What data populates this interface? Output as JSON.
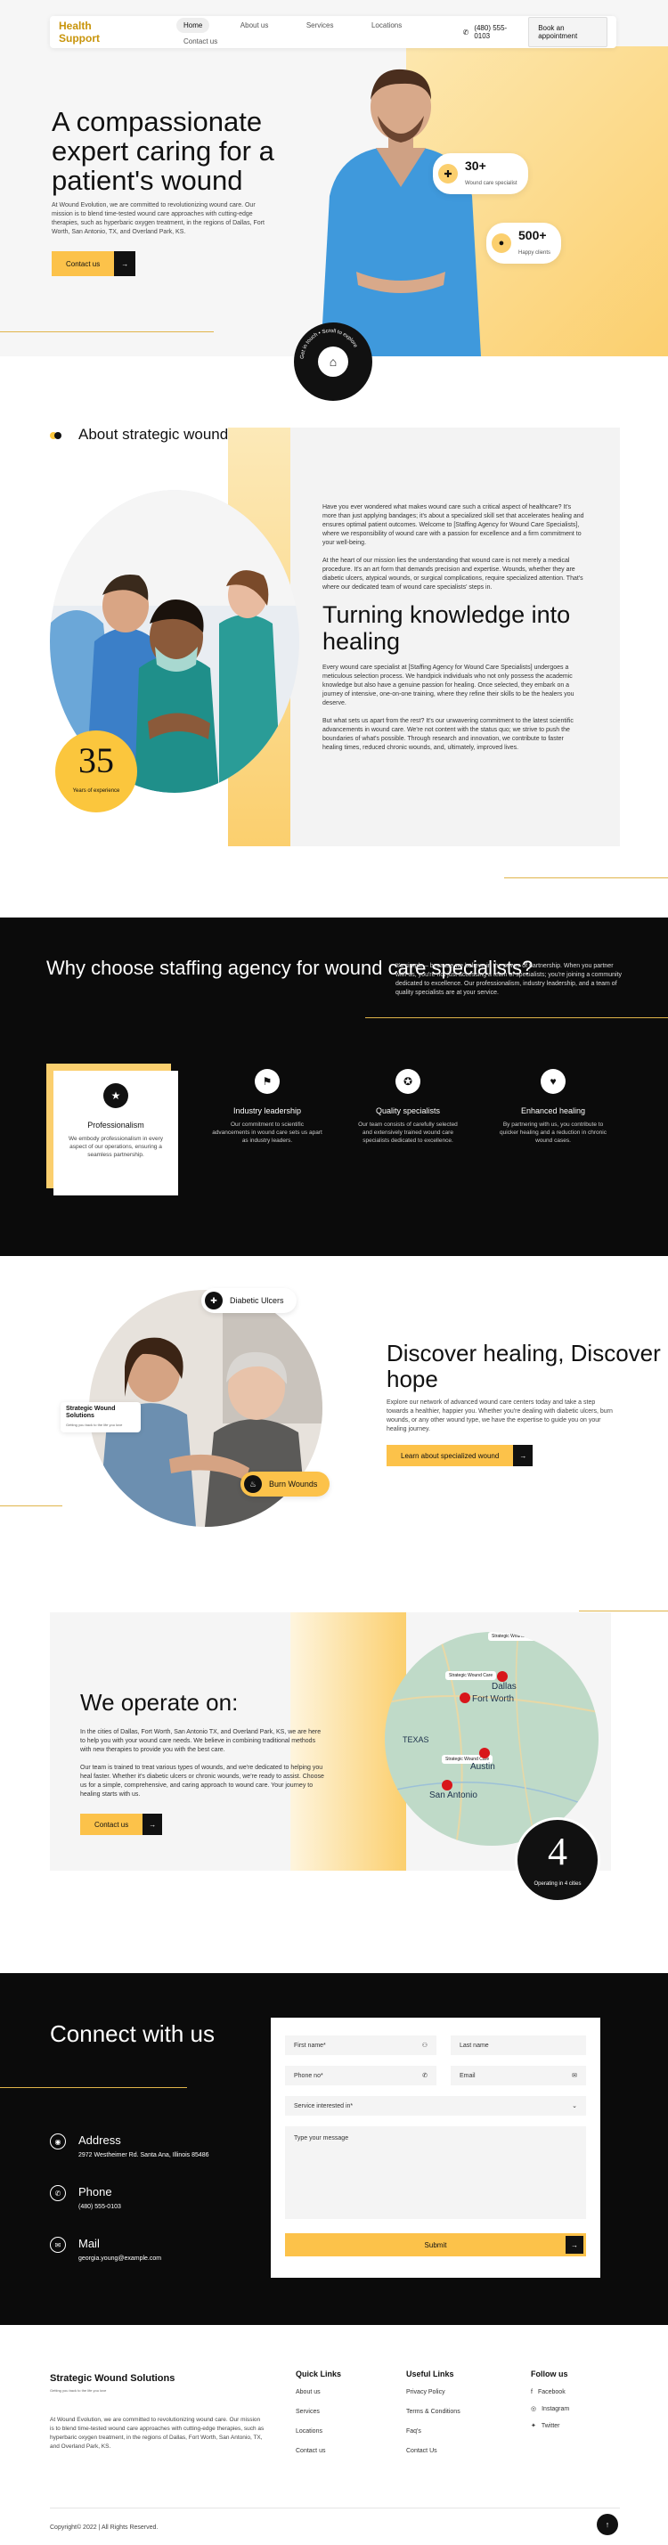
{
  "header": {
    "logo": "Health Support",
    "nav": [
      "Home",
      "About us",
      "Services",
      "Locations",
      "Contact us"
    ],
    "phone": "(480) 555-0103",
    "cta": "Book an appointment"
  },
  "hero": {
    "title": "A compassionate expert caring for a patient's wound",
    "text": "At Wound Evolution, we are committed to revolutionizing wound care. Our mission is to blend time-tested wound care approaches with cutting-edge therapies, such as hyperbaric oxygen treatment, in the regions of Dallas, Fort Worth, San Antonio, TX, and Overland Park, KS.",
    "button": "Contact us",
    "stat1_value": "30+",
    "stat1_label": "Wound care specialist",
    "stat2_value": "500+",
    "stat2_label": "Happy clients",
    "badge_text": "Get in touch • Scroll to explore"
  },
  "about": {
    "title": "About strategic wound solution",
    "years": "35",
    "years_label": "Years of experience",
    "p1": "Have you ever wondered what makes wound care such a critical aspect of healthcare? It's more than just applying bandages; it's about a specialized skill set that accelerates healing and ensures optimal patient outcomes. Welcome to [Staffing Agency for Wound Care Specialists], where we responsibility of wound care with a passion for excellence and a firm commitment to your well-being.",
    "p2": "At the heart of our mission lies the understanding that wound care is not merely a medical procedure. It's an art form that demands precision and expertise. Wounds, whether they are diabetic ulcers, atypical wounds, or surgical complications, require specialized attention. That's where our dedicated team of wound care specialists' steps in.",
    "heading": "Turning knowledge into healing",
    "p3": "Every wound care specialist at [Staffing Agency for Wound Care Specialists] undergoes a meticulous selection process. We handpick individuals who not only possess the academic knowledge but also have a genuine passion for healing. Once selected, they embark on a journey of intensive, one-on-one training, where they refine their skills to be the healers you deserve.",
    "p4": "But what sets us apart from the rest? It's our unwavering commitment to the latest scientific advancements in wound care. We're not content with the status quo; we strive to push the boundaries of what's possible. Through research and innovation, we contribute to faster healing times, reduced chronic wounds, and, ultimately, improved lives."
  },
  "why": {
    "title": "Why choose staffing agency for wound care specialists?",
    "text": "It's simple – because we believe in the power of partnership. When you partner with us, you're not just accessing a team of specialists; you're joining a community dedicated to excellence. Our professionalism, industry leadership, and a team of quality specialists are at your service.",
    "cards": [
      {
        "title": "Professionalism",
        "text": "We embody professionalism in every aspect of our operations, ensuring a seamless partnership."
      },
      {
        "title": "Industry leadership",
        "text": "Our commitment to scientific advancements in wound care sets us apart as industry leaders."
      },
      {
        "title": "Quality specialists",
        "text": "Our team consists of carefully selected and extensively trained wound care specialists dedicated to excellence."
      },
      {
        "title": "Enhanced healing",
        "text": "By partnering with us, you contribute to quicker healing and a reduction in chronic wound cases."
      }
    ]
  },
  "discover": {
    "pill1": "Diabetic Ulcers",
    "pill2": "Burn Wounds",
    "logo": "Strategic Wound Solutions",
    "logo_sub": "Getting you back to the life you love",
    "title": "Discover healing, Discover hope",
    "text": "Explore our network of advanced wound care centers today and take a step towards a healthier, happier you. Whether you're dealing with diabetic ulcers, burn wounds, or any other wound type, we have the expertise to guide you on your healing journey.",
    "button": "Learn about specialized wound"
  },
  "operate": {
    "title": "We operate on:",
    "p1": "In the cities of Dallas, Fort Worth, San Antonio TX, and Overland Park, KS, we are here to help you with your wound care needs. We believe in combining traditional methods with new therapies to provide you with the best care.",
    "p2": "Our team is trained to treat various types of wounds, and we're dedicated to helping you heal faster. Whether it's diabetic ulcers or chronic wounds, we're ready to assist. Choose us for a simple, comprehensive, and caring approach to wound care. Your journey to healing starts with us.",
    "button": "Contact us",
    "map_label": "Strategic Wound Care",
    "cities": [
      "Dallas",
      "Fort Worth",
      "Austin",
      "San Antonio",
      "TEXAS"
    ],
    "count": "4",
    "count_label": "Operating in 4 cities"
  },
  "contact": {
    "title": "Connect with us",
    "address_label": "Address",
    "address": "2972 Westheimer Rd. Santa Ana, Illinois 85486",
    "phone_label": "Phone",
    "phone": "(480) 555-0103",
    "mail_label": "Mail",
    "mail": "georgia.young@example.com",
    "fields": {
      "first": "First name*",
      "last": "Last name",
      "phone": "Phone no*",
      "email": "Email",
      "service": "Service interested in*",
      "message": "Type your message"
    },
    "submit": "Submit"
  },
  "footer": {
    "logo": "Strategic Wound Solutions",
    "logo_sub": "Getting you back to the life you love",
    "text": "At Wound Evolution, we are committed to revolutionizing wound care. Our mission is to blend time-tested wound care approaches with cutting-edge therapies, such as hyperbaric oxygen treatment, in the regions of Dallas, Fort Worth, San Antonio, TX, and Overland Park, KS.",
    "quick_title": "Quick Links",
    "quick": [
      "About us",
      "Services",
      "Locations",
      "Contact us"
    ],
    "useful_title": "Useful Links",
    "useful": [
      "Privacy Policy",
      "Terms & Conditions",
      "Faq's",
      "Contact Us"
    ],
    "follow_title": "Follow us",
    "social": [
      "Facebook",
      "Instagram",
      "Twitter"
    ],
    "copyright": "Copyright© 2022  |  All Rights Reserved."
  }
}
